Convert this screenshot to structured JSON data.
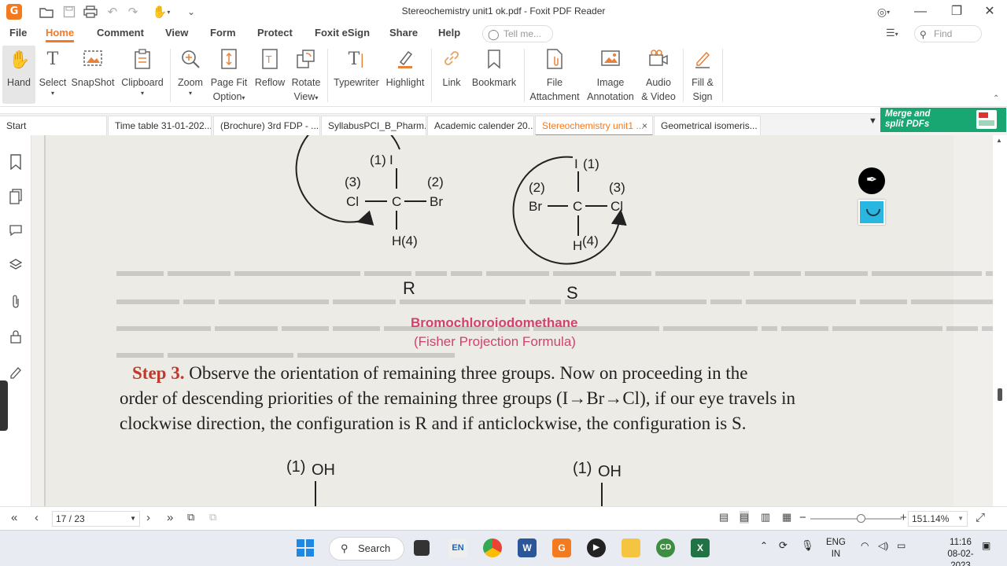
{
  "titlebar": {
    "title": "Stereochemistry unit1 ok.pdf - Foxit PDF Reader",
    "app_logo": "G"
  },
  "menu": {
    "items": [
      "File",
      "Home",
      "Comment",
      "View",
      "Form",
      "Protect",
      "Foxit eSign",
      "Share",
      "Help"
    ],
    "active": "Home",
    "tell_me_placeholder": "Tell me...",
    "find_placeholder": "Find"
  },
  "ribbon": {
    "hand": "Hand",
    "select": "Select",
    "snapshot": "SnapShot",
    "clipboard": "Clipboard",
    "zoom": "Zoom",
    "page_fit": "Page Fit",
    "page_fit_2": "Option",
    "reflow": "Reflow",
    "rotate": "Rotate",
    "rotate_2": "View",
    "typewriter": "Typewriter",
    "highlight": "Highlight",
    "link": "Link",
    "bookmark": "Bookmark",
    "file_attachment": "File",
    "file_attachment_2": "Attachment",
    "image_annotation": "Image",
    "image_annotation_2": "Annotation",
    "audio_video": "Audio",
    "audio_video_2": "& Video",
    "fill_sign": "Fill &",
    "fill_sign_2": "Sign"
  },
  "tabs": {
    "items": [
      "Start",
      "Time table 31-01-202...",
      "(Brochure) 3rd FDP - ...",
      "SyllabusPCI_B_Pharm....",
      "Academic calender 20...",
      "Stereochemistry unit1 ...",
      "Geometrical isomeris..."
    ],
    "close_glyph": "×",
    "ad_text_1": "Merge and",
    "ad_text_2": "split PDFs"
  },
  "document": {
    "r_label": "R",
    "s_label": "S",
    "caption_1": "Bromochloroiodomethane",
    "caption_2": "(Fisher Projection Formula)",
    "step_label": "Step 3.",
    "step_line_1": " Observe the orientation of remaining three groups. Now on proceeding in the",
    "step_line_2": "order of descending priorities of the remaining three groups (I→Br→Cl), if our eye travels in",
    "step_line_3": "clockwise direction, the configuration is R and if anticlockwise, the configuration is S.",
    "bottom_left_1": "(1)",
    "bottom_left_2": "OH",
    "bottom_right_1": "(1)",
    "bottom_right_2": "OH",
    "mol_r": {
      "top": "I",
      "top_num": "(1)",
      "left": "Cl",
      "left_num": "(3)",
      "right": "Br",
      "right_num": "(2)",
      "center": "C",
      "bottom": "H",
      "bottom_num": "(4)"
    },
    "mol_s": {
      "top": "I",
      "top_num": "(1)",
      "left": "Br",
      "left_num": "(2)",
      "right": "Cl",
      "right_num": "(3)",
      "center": "C",
      "bottom": "H",
      "bottom_num": "(4)"
    }
  },
  "statusbar": {
    "page": "17 / 23",
    "zoom": "151.14%"
  },
  "taskbar": {
    "search": "Search",
    "lang_1": "ENG",
    "lang_2": "IN",
    "time": "11:16",
    "date": "08-02-2023"
  },
  "colors": {
    "accent": "#f47a20",
    "caption_pink": "#d4416e",
    "step_red": "#c0392b",
    "ad_green": "#18a672"
  }
}
